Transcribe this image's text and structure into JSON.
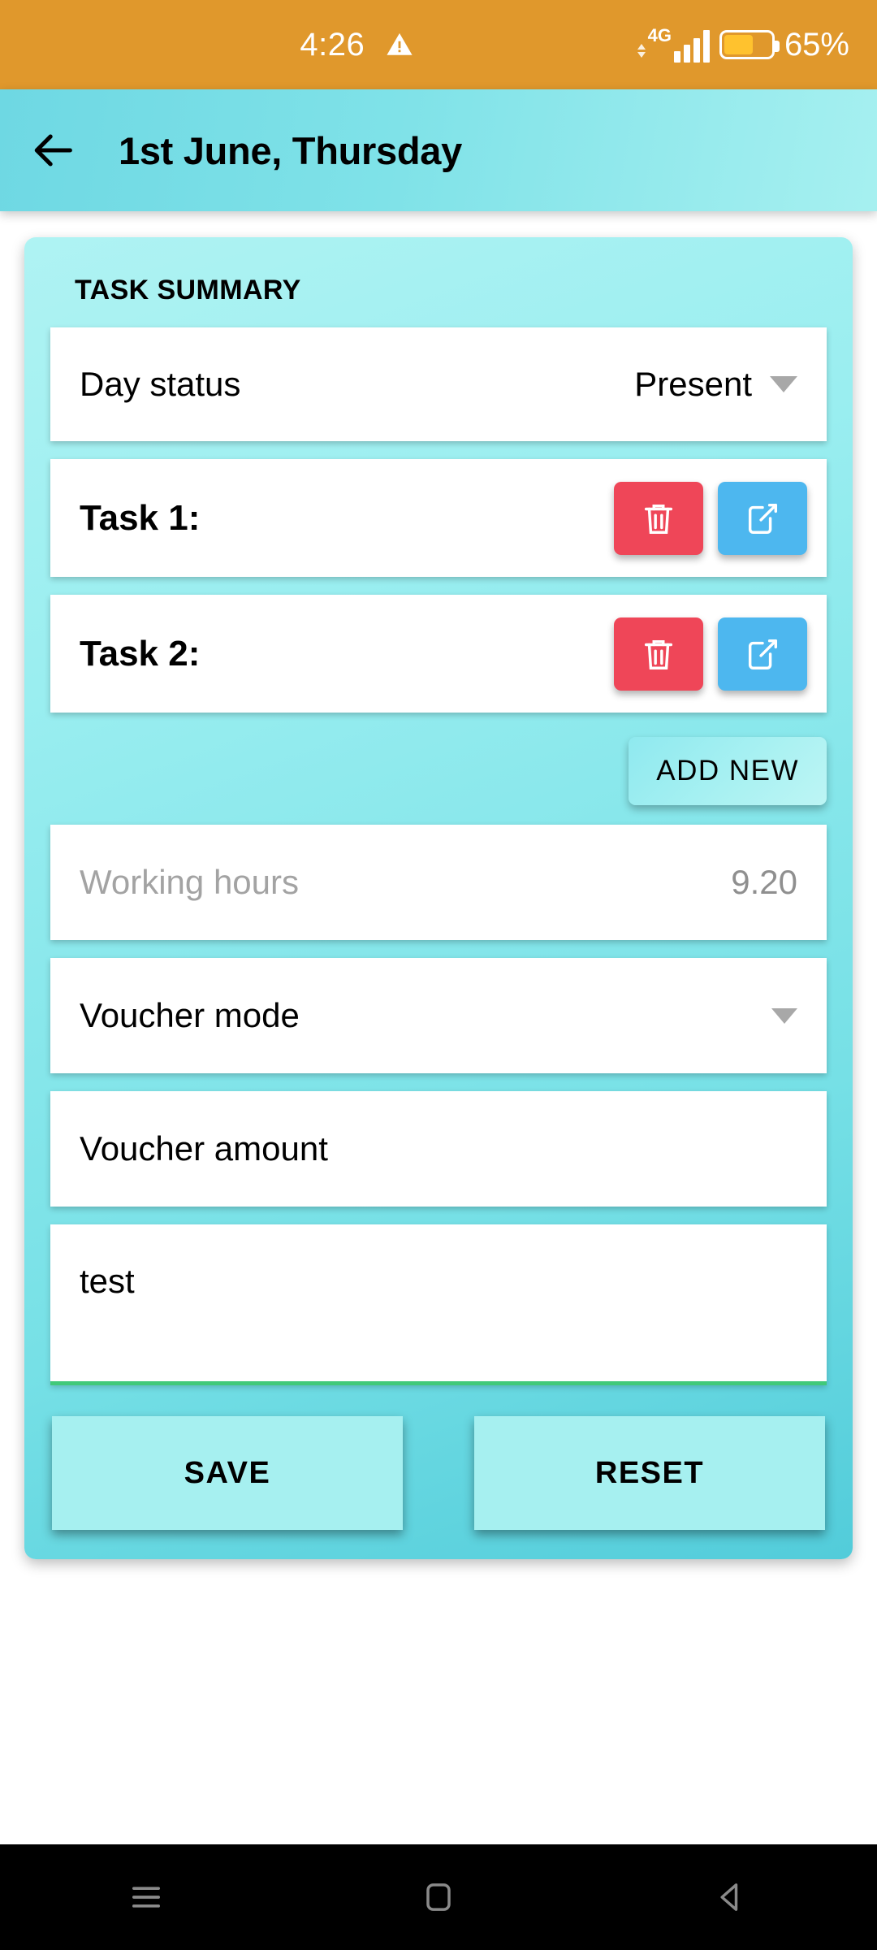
{
  "status_bar": {
    "time": "4:26",
    "warning_icon": "warning-triangle-icon",
    "network_type": "4G",
    "signal_icon": "signal-bars-icon",
    "battery_icon": "battery-icon",
    "battery_percent": "65%"
  },
  "app_bar": {
    "back_icon": "back-arrow-icon",
    "title": "1st June, Thursday"
  },
  "card": {
    "heading": "TASK SUMMARY",
    "day_status": {
      "label": "Day status",
      "value": "Present",
      "dropdown_icon": "chevron-down-icon"
    },
    "tasks": [
      {
        "label": "Task 1:",
        "delete_icon": "trash-icon",
        "edit_icon": "edit-icon"
      },
      {
        "label": "Task 2:",
        "delete_icon": "trash-icon",
        "edit_icon": "edit-icon"
      }
    ],
    "add_new_label": "ADD NEW",
    "working_hours": {
      "placeholder": "Working hours",
      "value": "9.20"
    },
    "voucher_mode": {
      "label": "Voucher mode",
      "dropdown_icon": "chevron-down-icon"
    },
    "voucher_amount": {
      "label": "Voucher amount"
    },
    "note": {
      "value": "test"
    },
    "save_label": "SAVE",
    "reset_label": "RESET"
  },
  "nav_bar": {
    "recents_icon": "menu-icon",
    "home_icon": "home-square-icon",
    "back_icon": "back-triangle-icon"
  },
  "colors": {
    "status_bar_bg": "#e0982c",
    "app_bar_bg": "#7fe2e8",
    "card_bg": "#9aeef0",
    "delete_red": "#ef4658",
    "edit_blue": "#4db7ef",
    "note_underline_green": "#41c97a",
    "button_cyan": "#a6f0f0"
  }
}
